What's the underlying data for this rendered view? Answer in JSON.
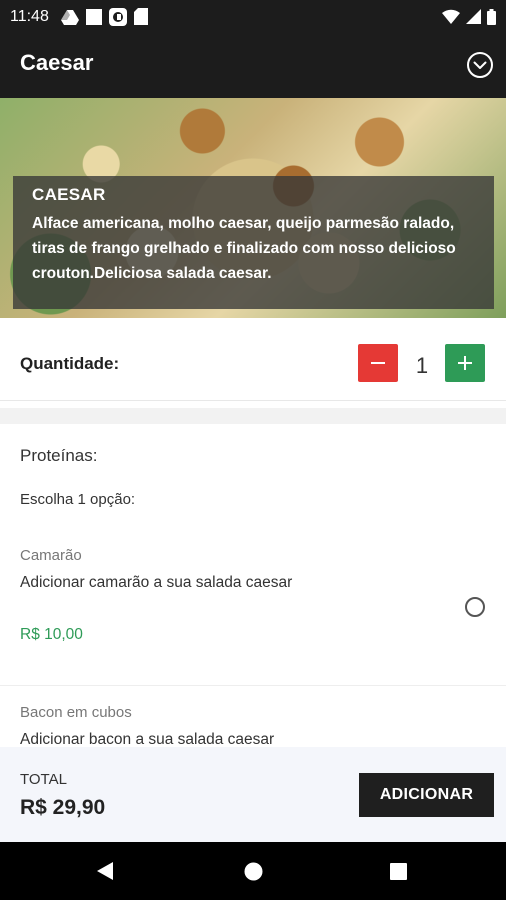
{
  "status_bar": {
    "time": "11:48"
  },
  "app_bar": {
    "title": "Caesar"
  },
  "product": {
    "name": "CAESAR",
    "description": "Alface americana, molho caesar, queijo parmesão ralado, tiras de frango grelhado e finalizado com nosso delicioso crouton.Deliciosa salada caesar."
  },
  "quantity": {
    "label": "Quantidade:",
    "value": "1"
  },
  "section": {
    "title": "Proteínas:",
    "subtitle": "Escolha 1 opção:"
  },
  "options": [
    {
      "name": "Camarão",
      "description": "Adicionar camarão a sua salada caesar",
      "price": "R$ 10,00"
    },
    {
      "name": "Bacon em cubos",
      "description": "Adicionar bacon a sua salada caesar"
    }
  ],
  "footer": {
    "total_label": "TOTAL",
    "total_value": "R$ 29,90",
    "add_label": "ADICIONAR"
  },
  "colors": {
    "minus": "#e53935",
    "plus": "#2e9b57",
    "price": "#2e9b57",
    "bar": "#1c1c1c"
  }
}
